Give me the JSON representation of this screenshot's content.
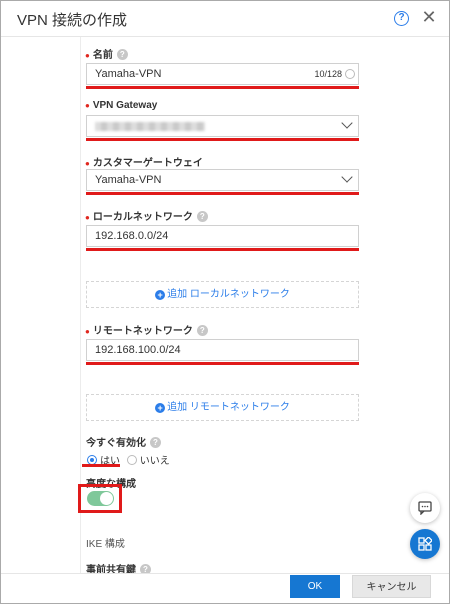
{
  "dialog": {
    "title": "VPN 接続の作成",
    "help_icon": "question-circle-icon",
    "close_icon": "close-icon"
  },
  "fields": {
    "name": {
      "label": "名前",
      "required": true,
      "value": "Yamaha-VPN",
      "counter": "10/128"
    },
    "vpn_gateway": {
      "label": "VPN Gateway",
      "required": true,
      "value": ""
    },
    "customer_gateway": {
      "label": "カスタマーゲートウェイ",
      "required": true,
      "value": "Yamaha-VPN"
    },
    "local_network": {
      "label": "ローカルネットワーク",
      "required": true,
      "value": "192.168.0.0/24",
      "add_label": "追加 ローカルネットワーク"
    },
    "remote_network": {
      "label": "リモートネットワーク",
      "required": true,
      "value": "192.168.100.0/24",
      "add_label": "追加 リモートネットワーク"
    },
    "activate_now": {
      "label": "今すぐ有効化",
      "options": [
        "はい",
        "いいえ"
      ],
      "selected": "はい"
    },
    "advanced": {
      "label": "高度な構成",
      "enabled": true
    },
    "ike_section": "IKE 構成",
    "psk_label": "事前共有鍵"
  },
  "footer": {
    "ok_label": "OK",
    "cancel_label": "キャンセル"
  },
  "colors": {
    "accent": "#1677d2",
    "required": "#e0271f",
    "highlight": "#e01a1a",
    "toggle_on": "#7fc89a"
  },
  "floating": [
    "chat-icon",
    "grid-icon"
  ]
}
